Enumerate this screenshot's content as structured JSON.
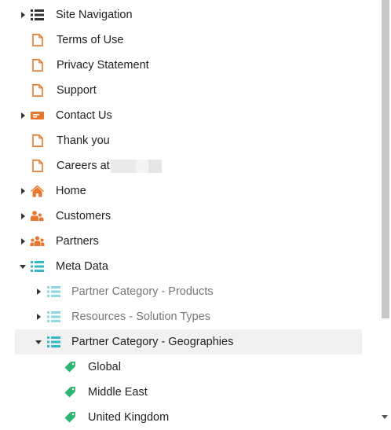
{
  "tree": {
    "items": [
      {
        "label": "Site Navigation",
        "icon": "list-icon"
      },
      {
        "label": "Terms of Use",
        "icon": "page-icon"
      },
      {
        "label": "Privacy Statement",
        "icon": "page-icon"
      },
      {
        "label": "Support",
        "icon": "page-icon"
      },
      {
        "label": "Contact Us",
        "icon": "form-icon"
      },
      {
        "label": "Thank you",
        "icon": "page-icon"
      },
      {
        "label": "Careers at",
        "icon": "page-icon"
      },
      {
        "label": "Home",
        "icon": "home-icon"
      },
      {
        "label": "Customers",
        "icon": "people-icon"
      },
      {
        "label": "Partners",
        "icon": "people-icon"
      },
      {
        "label": "Meta Data",
        "icon": "metadata-list-icon"
      },
      {
        "label": "Partner Category - Products",
        "icon": "metadata-list-icon"
      },
      {
        "label": "Resources - Solution Types",
        "icon": "metadata-list-icon"
      },
      {
        "label": "Partner Category - Geographies",
        "icon": "metadata-list-icon"
      },
      {
        "label": "Global",
        "icon": "tag-icon"
      },
      {
        "label": "Middle East",
        "icon": "tag-icon"
      },
      {
        "label": "United Kingdom",
        "icon": "tag-icon"
      }
    ]
  },
  "colors": {
    "page_orange": "#e8772e",
    "meta_teal": "#35b7c6",
    "tag_green": "#2bb673",
    "dark_icon": "#333333"
  }
}
